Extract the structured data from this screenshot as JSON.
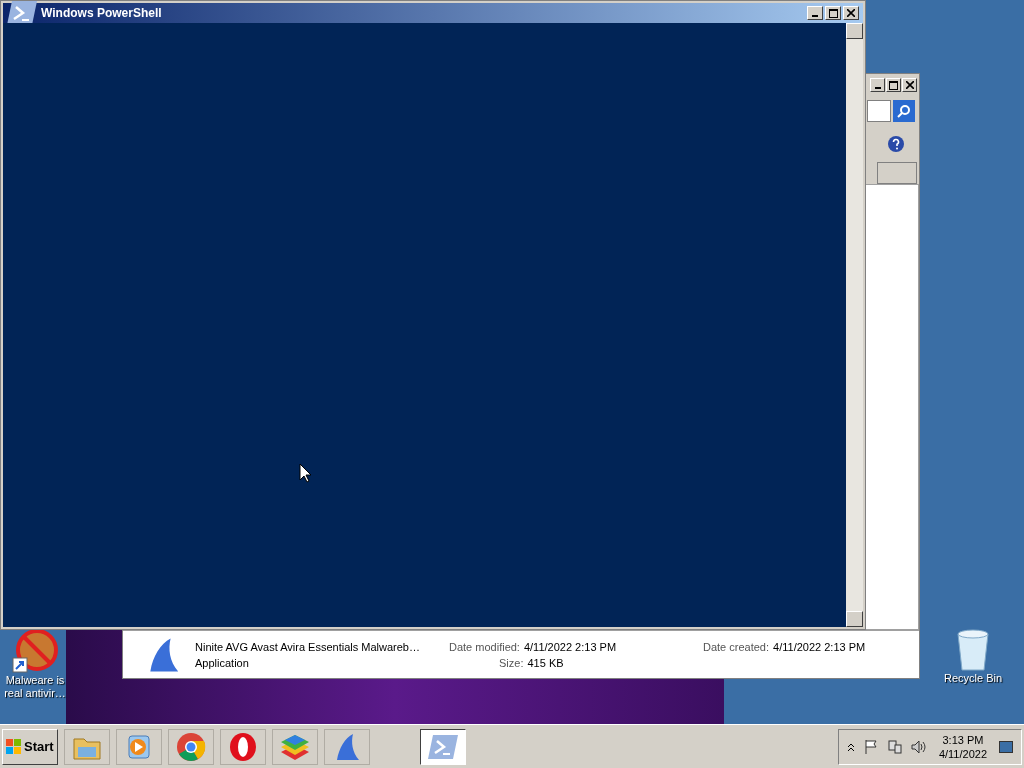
{
  "powershell_window": {
    "title": "Windows PowerShell"
  },
  "explorer_window": {
    "details": {
      "name": "Ninite AVG Avast Avira Essentials Malwareb…",
      "type": "Application",
      "date_modified_label": "Date modified:",
      "date_modified": "4/11/2022 2:13 PM",
      "date_created_label": "Date created:",
      "date_created": "4/11/2022 2:13 PM",
      "size_label": "Size:",
      "size": "415 KB"
    }
  },
  "desktop_icons": [
    {
      "kind": "shortcut",
      "label": "Malweare is real antivir…"
    },
    {
      "kind": "recycle",
      "label": "Recycle Bin"
    }
  ],
  "taskbar": {
    "start": "Start",
    "apps": [
      {
        "kind": "folder",
        "active": false
      },
      {
        "kind": "media",
        "active": false
      },
      {
        "kind": "chrome",
        "active": false
      },
      {
        "kind": "opera",
        "active": false
      },
      {
        "kind": "stack",
        "active": false
      },
      {
        "kind": "shark",
        "active": false
      },
      {
        "kind": "powershell",
        "active": true
      }
    ],
    "clock": {
      "time": "3:13 PM",
      "date": "4/11/2022"
    }
  }
}
